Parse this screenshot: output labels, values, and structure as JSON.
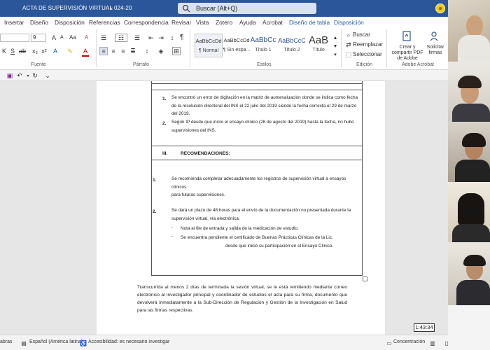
{
  "titlebar": {
    "doc_title": "ACTA DE SUPERVISIÓN VIRTUAL 024-20",
    "dropdown": "⌄",
    "search_placeholder": "Buscar (Alt+Q)"
  },
  "tabs": [
    "Insertar",
    "Diseño",
    "Disposición",
    "Referencias",
    "Correspondencia",
    "Revisar",
    "Vista",
    "Zotero",
    "Ayuda",
    "Acrobat",
    "Diseño de tabla",
    "Disposición"
  ],
  "ribbon": {
    "font_size": "9",
    "font_size_up": "A",
    "font_size_down": "A",
    "change_case": "Aa",
    "clear_format": "A",
    "group_font": "Fuente",
    "group_paragraph": "Párrafo",
    "group_styles": "Estilos",
    "group_edit": "Edición",
    "group_acrobat": "Adobe Acrobat",
    "pilcrow": "¶",
    "styles": [
      {
        "preview": "AaBbCcDd",
        "name": "¶ Normal"
      },
      {
        "preview": "AaBbCcDd",
        "name": "¶ Sin espa..."
      },
      {
        "preview": "AaBbCc",
        "name": "Título 1"
      },
      {
        "preview": "AaBbCcC",
        "name": "Título 2"
      },
      {
        "preview": "AaB",
        "name": "Título"
      }
    ],
    "find": "Buscar",
    "replace": "Reemplazar",
    "select": "Seleccionar",
    "create_pdf": "Crear y compartir PDF de Adobe",
    "request_sign": "Solicitar firmas"
  },
  "document": {
    "items_top": [
      {
        "n": "1.",
        "lines": [
          "Se encontró un error de digitación en la matriz de autoevaluación donde se indica como fecha",
          "de la resolución directoral del INS el 22 julio del 2019 siendo la fecha correcta el 29 de marzo",
          "del 2019."
        ]
      },
      {
        "n": "2.",
        "lines": [
          "Según IP desde que inicio el ensayo clínico (28 de agosto del 2019) hasta la fecha, no hubo",
          "supervisiones del INS."
        ]
      }
    ],
    "section_num": "III.",
    "section_title": "RECOMENDACIONES:",
    "recs": [
      {
        "n": "1.",
        "lines": [
          "Se recomienda completar adecuadamente los registros de supervisión virtual a ensayos clínicos",
          "para futuras supervisiones."
        ]
      },
      {
        "n": "2.",
        "lines": [
          "Se dará un plazo de 48 horas para el envío de la documentación no presentada durante la",
          "supervisión virtual, vía electrónica:"
        ]
      }
    ],
    "subs": [
      "Nota al file de entrada y salida de la medicación de estudio.",
      "Se encuentra pendiente el certificado de Buenas Prácticas Clínicas de la Lic."
    ],
    "sub_cont": "desde que inició su participación en el Ensayo Clínico.",
    "closing": "Transcurrida al menos 2 días de terminada la sesión virtual, se le está remitiendo mediante correo electrónico al investigador principal y coordinador de estudios el acta para su firma, documento que devolverá inmediatamente a la Sub-Dirección de Regulación y Gestión de la Investigación en Salud para las firmas respectivas."
  },
  "statusbar": {
    "words": "abras",
    "language": "Español (América latina)",
    "accessibility": "Accesibilidad: es necesario investigar",
    "focus": "Concentración"
  },
  "timer": "1:43:34",
  "colors": {
    "word_blue": "#2b579a",
    "accent_yellow": "#f2c811"
  }
}
